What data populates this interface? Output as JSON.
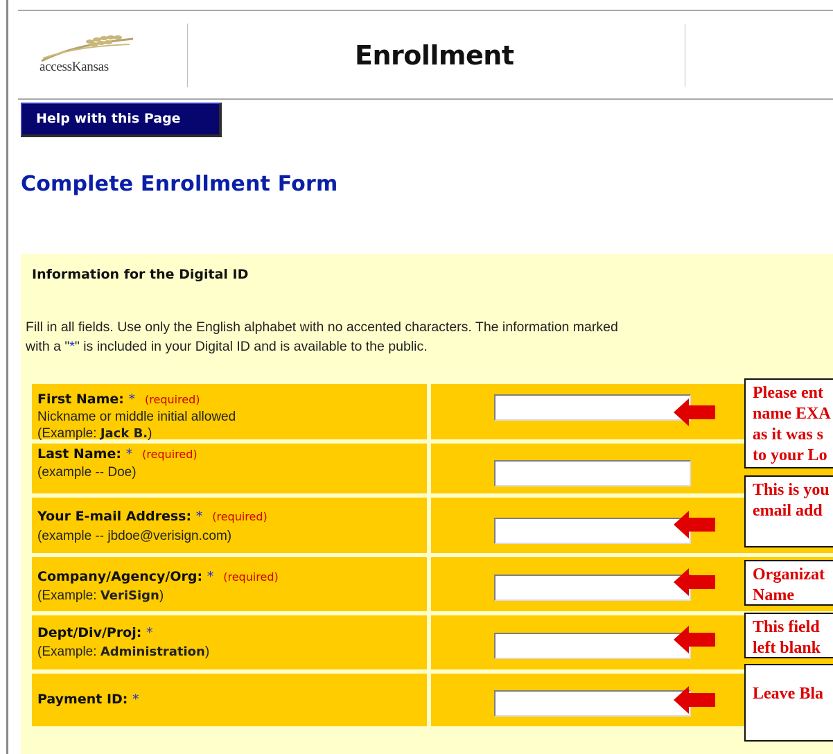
{
  "header": {
    "logo_text": "accessKansas",
    "title": "Enrollment"
  },
  "help_button": "Help with this Page",
  "form_heading": "Complete Enrollment Form",
  "panel": {
    "title": "Information for the Digital ID",
    "instructions_line1": "Fill in all fields. Use only the English alphabet with no accented characters. The information marked",
    "instructions_line2_a": "with a \"",
    "instructions_line2_star": "*",
    "instructions_line2_b": "\" is included in your Digital ID and is available to the public."
  },
  "fields": [
    {
      "label": "First Name:",
      "star": "*",
      "required": "(required)",
      "hint1": "Nickname or middle initial allowed",
      "hint2_prefix": "(Example: ",
      "hint2_bold": "Jack B.",
      "hint2_suffix": ")",
      "value": ""
    },
    {
      "label": "Last Name:",
      "star": "*",
      "required": "(required)",
      "hint1": "(example -- Doe)",
      "value": ""
    },
    {
      "label": "Your E-mail Address:",
      "star": "*",
      "required": "(required)",
      "hint1": "(example -- jbdoe@verisign.com)",
      "value": ""
    },
    {
      "label": "Company/Agency/Org:",
      "star": "*",
      "required": "(required)",
      "hint2_prefix": "(Example: ",
      "hint2_bold": "VeriSign",
      "hint2_suffix": ")",
      "value": ""
    },
    {
      "label": "Dept/Div/Proj:",
      "star": "*",
      "hint2_prefix": "(Example: ",
      "hint2_bold": "Administration",
      "hint2_suffix": ")",
      "value": ""
    },
    {
      "label": "Payment ID:",
      "star": "*",
      "value": ""
    }
  ],
  "callouts": [
    {
      "lines": [
        "Please ent",
        "name EXA",
        "as it was s",
        "to your Lo"
      ]
    },
    {
      "lines": [
        "This is you",
        "email add"
      ]
    },
    {
      "lines": [
        "Organizat",
        "Name"
      ]
    },
    {
      "lines": [
        "This field",
        "left blank"
      ]
    },
    {
      "lines": [
        "Leave Bla"
      ]
    }
  ],
  "colors": {
    "row_bg": "#ffcc00",
    "panel_bg": "#ffffcc",
    "heading_blue": "#0a1fa8",
    "callout_red": "#dd0000",
    "button_navy": "#06066e"
  }
}
